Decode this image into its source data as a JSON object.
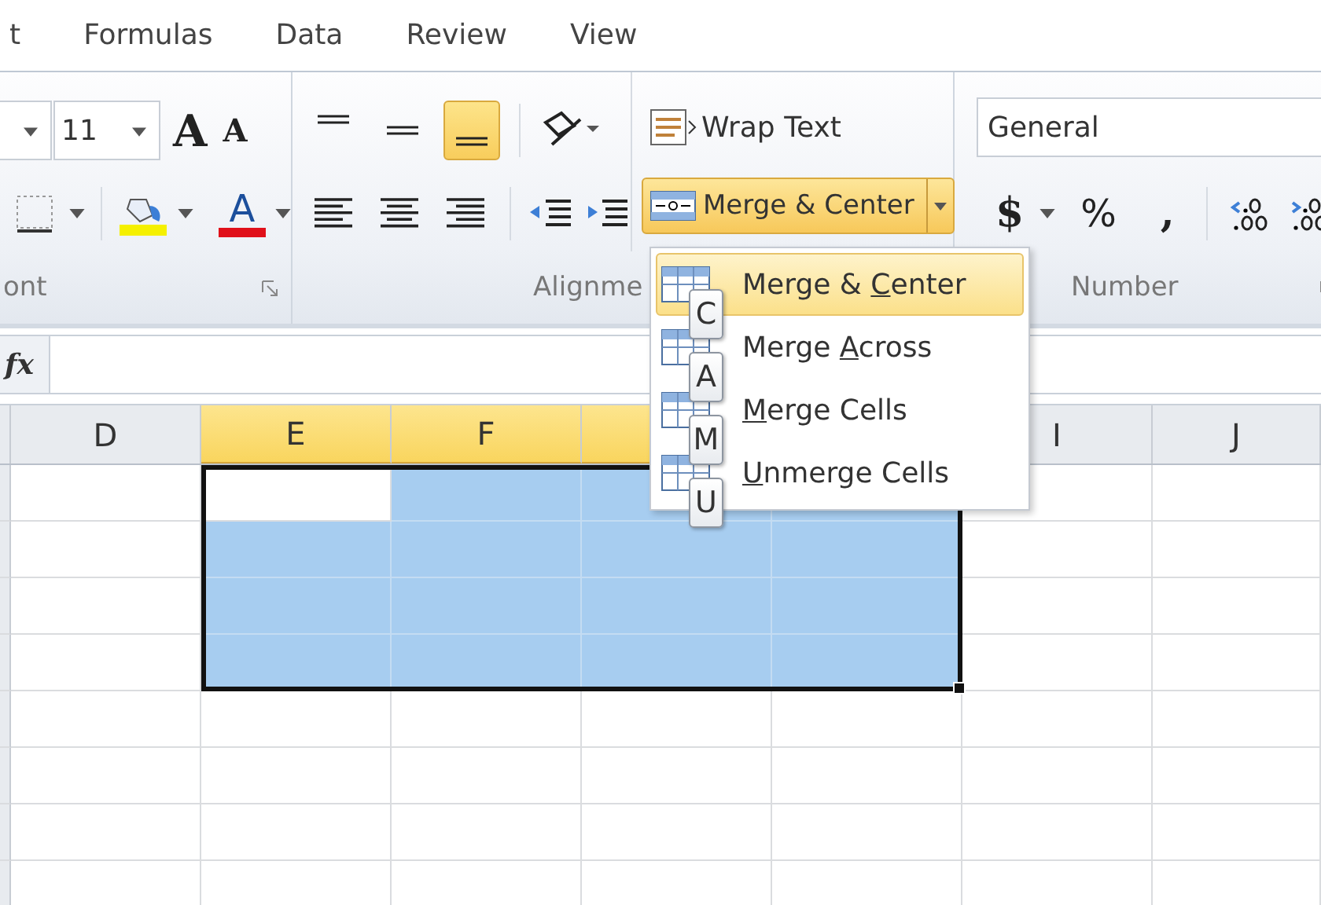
{
  "tabs": [
    {
      "label": "t",
      "selected": false
    },
    {
      "label": "Formulas",
      "selected": false
    },
    {
      "label": "Data",
      "selected": false
    },
    {
      "label": "Review",
      "selected": false
    },
    {
      "label": "View",
      "selected": false
    }
  ],
  "font_group": {
    "label": "ont",
    "size": "11",
    "grow": "A",
    "shrink": "A",
    "font_color": "A"
  },
  "alignment_group": {
    "label": "Alignme",
    "vertical": [
      {
        "kind": "top",
        "selected": false
      },
      {
        "kind": "middle",
        "selected": false
      },
      {
        "kind": "bottom",
        "selected": true
      }
    ],
    "horizontal": [
      {
        "kind": "left",
        "selected": false
      },
      {
        "kind": "center",
        "selected": false
      },
      {
        "kind": "right",
        "selected": false
      }
    ],
    "wrap_text": "Wrap Text",
    "merge": {
      "label": "Merge & Center",
      "open": true
    }
  },
  "number_group": {
    "label": "Number",
    "format": "General",
    "currency": "$",
    "percent": "%",
    "comma": ","
  },
  "formula_bar": {
    "fx": "fx"
  },
  "merge_menu": {
    "items": [
      {
        "before": "Merge & ",
        "accel": "C",
        "after": "enter",
        "key_tip": "C",
        "selected": true
      },
      {
        "before": "Merge ",
        "accel": "A",
        "after": "cross",
        "key_tip": "A",
        "selected": false
      },
      {
        "accel": "M",
        "after": "erge Cells",
        "key_tip": "M",
        "selected": false
      },
      {
        "accel": "U",
        "after": "nmerge Cells",
        "key_tip": "U",
        "selected": false
      }
    ]
  },
  "sheet": {
    "columns": [
      {
        "label": "D",
        "selected": false
      },
      {
        "label": "E",
        "selected": true
      },
      {
        "label": "F",
        "selected": true
      },
      {
        "selected": true
      },
      {
        "selected": true
      },
      {
        "label": "I",
        "selected": false
      },
      {
        "label": "J",
        "selected": false
      }
    ],
    "rows": [
      {
        "selected": true
      },
      {
        "selected": true
      },
      {
        "selected": true
      },
      {
        "selected": true
      },
      {
        "selected": false
      },
      {
        "selected": false
      },
      {
        "selected": false
      },
      {
        "selected": false
      }
    ]
  }
}
